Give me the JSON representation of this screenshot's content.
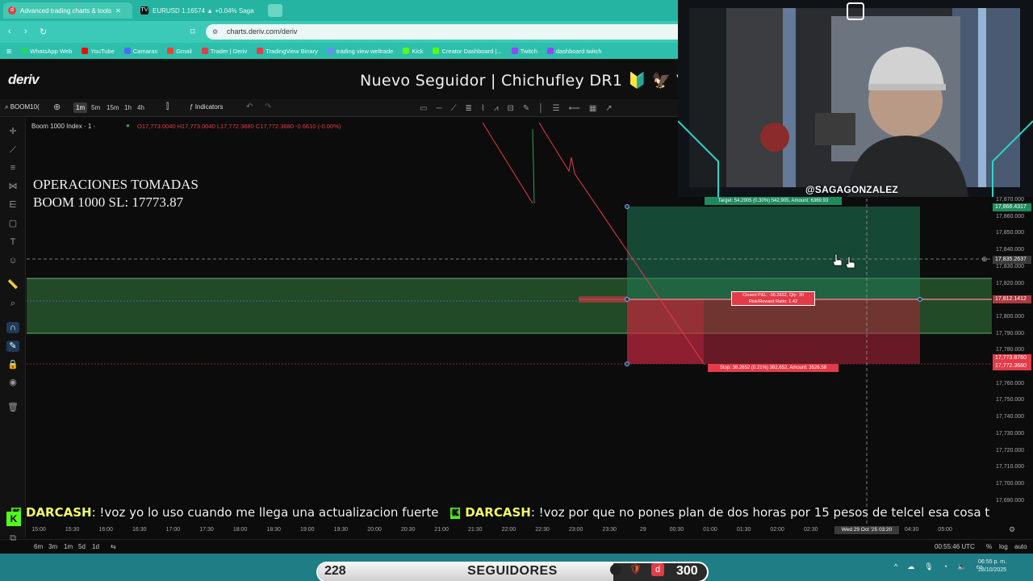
{
  "browser": {
    "tabs": [
      {
        "title": "Advanced trading charts & tools",
        "active": true
      },
      {
        "title": "EURUSD 1.16574 ▲ +0.04% Saga",
        "active": false
      }
    ],
    "url": "charts.deriv.com/deriv",
    "bookmarks": [
      "WhatsApp Web",
      "YouTube",
      "Camaras",
      "Gmail",
      "Trader | Deriv",
      "TradingView Binary",
      "trading view weltrade",
      "Kick",
      "Creator Dashboard |...",
      "Twitch",
      "dashboard twitch"
    ]
  },
  "header": {
    "logo": "deriv",
    "banner": "Nuevo Seguidor | Chichufley DR1 🔰 🦅 VE 💙 HN 🇭🇳"
  },
  "toolbar": {
    "symbol": "BOOM10(",
    "timeframes": [
      "1m",
      "5m",
      "15m",
      "1h",
      "4h"
    ],
    "selected_timeframe": "1m",
    "indicators_label": "Indicators"
  },
  "chart": {
    "legend_title": "Boom 1000 Index · 1 ·",
    "ohlc": "O17,773.0040 H17,773.0040 L17,772.3680 C17,772.3680 -0.6610 (-0.00%)",
    "overlay_line1": "OPERACIONES TOMADAS",
    "overlay_line2": "BOOM 1000 SL: 17773.87",
    "target_label": "Target: 54.2905 (0.30%) 542,905, Amount: 6369.93",
    "closed_label_1": "Closed P&L: -38.2652, Qty: 30",
    "closed_label_2": "Risk/Reward Ratio: 1.42",
    "stop_label": "Stop: 38.2652 (0.21%) 382,652, Amount: 3526.58",
    "price_ticks": [
      "17,870.000",
      "17,860.000",
      "17,850.000",
      "17,840.000",
      "17,830.000",
      "17,820.000",
      "17,810.000",
      "17,800.000",
      "17,790.000",
      "17,780.000",
      "17,770.000",
      "17,760.000",
      "17,750.000",
      "17,740.000",
      "17,730.000",
      "17,720.000",
      "17,710.000",
      "17,700.000",
      "17,690.000"
    ],
    "price_labels": {
      "target": "17,866.4317",
      "crosshair": "17,835.2637",
      "entry": "17,812.1412",
      "stop_a": "17,773.8760",
      "stop_b": "17,772.3680"
    },
    "time_ticks": [
      "15:00",
      "15:30",
      "16:00",
      "16:30",
      "17:00",
      "17:30",
      "18:00",
      "18:30",
      "19:00",
      "19:30",
      "20:00",
      "20:30",
      "21:00",
      "21:30",
      "22:00",
      "22:30",
      "23:00",
      "23:30",
      "29",
      "00:30",
      "01:00",
      "01:30",
      "02:00",
      "02:30",
      "03:20",
      "04:00",
      "04:30",
      "05:00"
    ],
    "crosshair_time": "Wed 29 Oct '25   03:20",
    "ranges": [
      "6m",
      "3m",
      "1m",
      "5d",
      "1d"
    ],
    "utc_time": "00:55:46 UTC",
    "scale_opts": [
      "%",
      "log",
      "auto"
    ]
  },
  "ticker": {
    "messages": [
      {
        "user": "DARCASH",
        "text": ": !voz yo lo uso cuando me llega una actualizacion fuerte"
      },
      {
        "user": "DARCASH",
        "text": ": !voz por que no pones plan de dos horas por 15 pesos de telcel esa cosa t"
      }
    ]
  },
  "webcam": {
    "handle": "@SAGAGONZALEZ"
  },
  "followers": {
    "current": "228",
    "label": "SEGUIDORES",
    "goal": "300",
    "progress": 0.76
  },
  "taskbar": {
    "time": "06:55 p. m.",
    "date": "28/10/2025"
  },
  "colors": {
    "accent": "#26b4a2",
    "bull": "#2ea05a",
    "bear": "#e33b48"
  }
}
